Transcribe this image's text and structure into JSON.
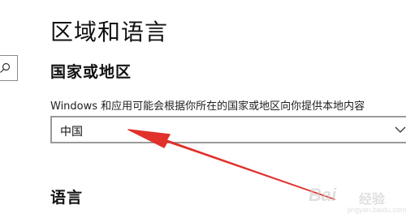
{
  "page_title": "区域和语言",
  "region_section": {
    "title": "国家或地区",
    "description": "Windows 和应用可能会根据你所在的国家或地区向你提供本地内容",
    "selected_value": "中国"
  },
  "language_section": {
    "title": "语言"
  },
  "icons": {
    "search": "search-icon",
    "dropdown": "chevron-down-icon"
  },
  "watermark": {
    "brand": "Bai",
    "sub": "经验",
    "url": "jingyan.baidu.com"
  },
  "colors": {
    "annotation_arrow": "#e0312b",
    "border": "#9a9a9a"
  }
}
